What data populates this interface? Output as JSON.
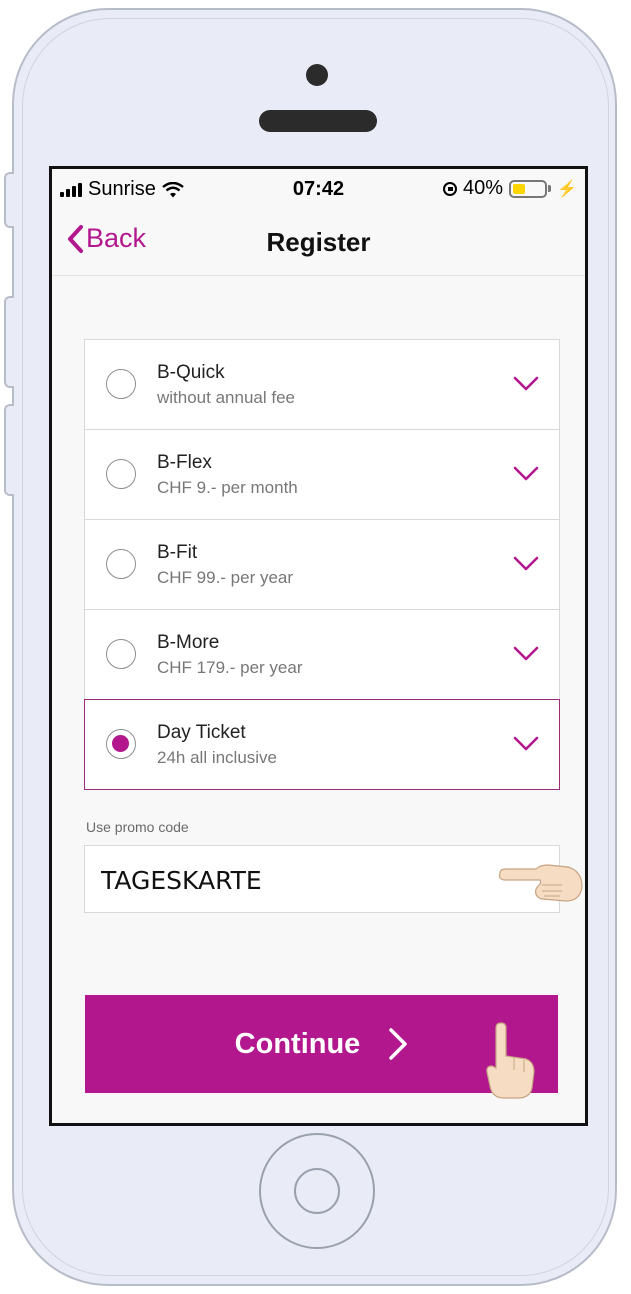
{
  "status_bar": {
    "carrier": "Sunrise",
    "time": "07:42",
    "battery_percent": "40%",
    "battery_level": 0.4,
    "battery_color": "#ffd500"
  },
  "nav": {
    "back_label": "Back",
    "title": "Register"
  },
  "plans": [
    {
      "name": "B-Quick",
      "desc": "without annual fee",
      "selected": false
    },
    {
      "name": "B-Flex",
      "desc": "CHF 9.- per month",
      "selected": false
    },
    {
      "name": "B-Fit",
      "desc": "CHF 99.- per year",
      "selected": false
    },
    {
      "name": "B-More",
      "desc": "CHF 179.- per year",
      "selected": false
    },
    {
      "name": "Day Ticket",
      "desc": "24h all inclusive",
      "selected": true
    }
  ],
  "promo": {
    "label": "Use promo code",
    "value": "TAGESKARTE"
  },
  "continue_label": "Continue",
  "icons": {
    "back": "chevron-left-icon",
    "expand": "chevron-down-icon",
    "continue": "chevron-right-icon",
    "hint_point": "pointing-hand-icon",
    "hint_tap": "tapping-hand-icon"
  },
  "colors": {
    "accent": "#b2178e",
    "selected_border": "#9e2a7e"
  }
}
